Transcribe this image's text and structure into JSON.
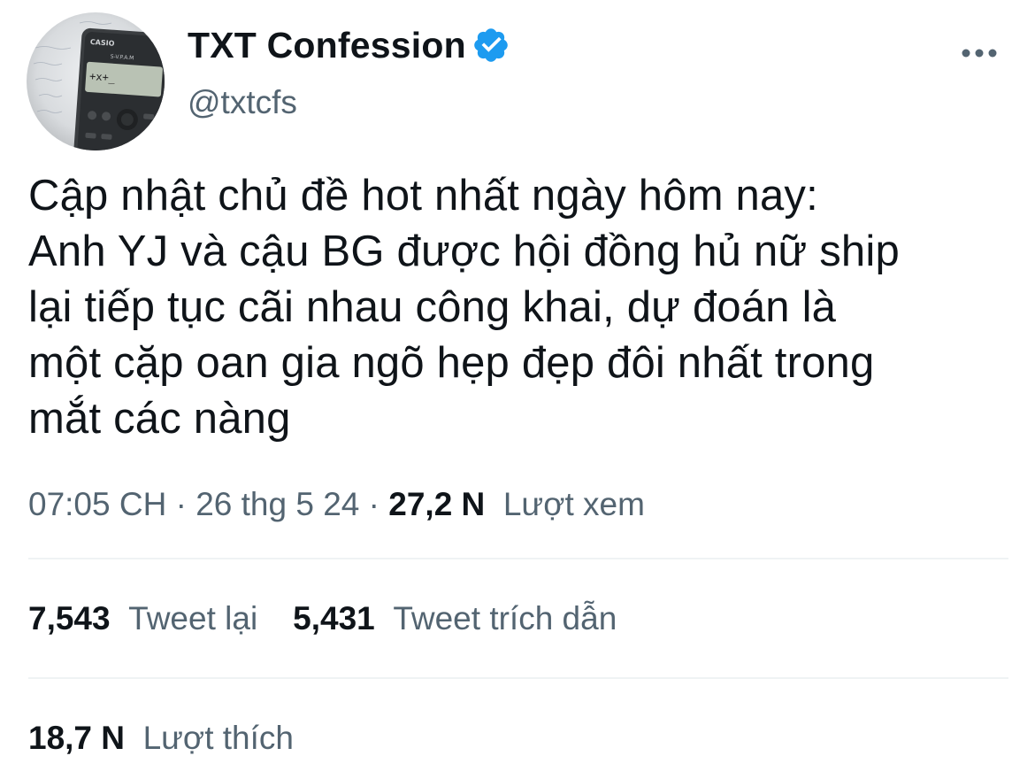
{
  "author": {
    "display_name": "TXT Confession",
    "handle": "@txtcfs",
    "verified_icon": "verified-badge-icon",
    "avatar_calc_brand": "CASIO",
    "avatar_calc_model": "S-V.P.A.M",
    "avatar_calc_display": "+x+_"
  },
  "tweet": {
    "lines": [
      "Cập nhật chủ đề hot nhất ngày hôm nay:",
      "Anh YJ và cậu BG được hội đồng hủ nữ ship",
      "lại tiếp tục cãi nhau công khai, dự đoán là",
      "một cặp oan gia ngõ hẹp đẹp đôi nhất trong",
      "mắt các nàng"
    ]
  },
  "meta": {
    "time": "07:05 CH",
    "separator": " · ",
    "date": "26 thg 5 24",
    "views_count": "27,2 N",
    "views_label": "Lượt xem"
  },
  "stats": {
    "retweets_count": "7,543",
    "retweets_label": "Tweet lại",
    "quotes_count": "5,431",
    "quotes_label": "Tweet trích dẫn",
    "likes_count": "18,7 N",
    "likes_label": "Lượt thích"
  },
  "colors": {
    "text_primary": "#0f1419",
    "text_secondary": "#536471",
    "verified_blue": "#1d9bf0",
    "divider": "#eff3f4"
  }
}
